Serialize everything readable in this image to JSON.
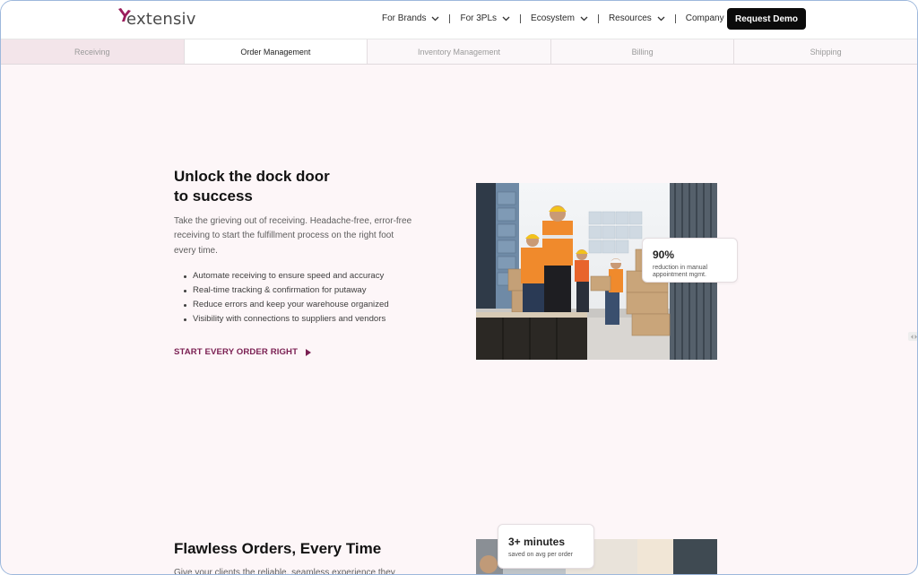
{
  "brand": {
    "logo_text": "extensiv",
    "accent": "#9b1d5c"
  },
  "nav": {
    "items": [
      {
        "label": "For Brands"
      },
      {
        "label": "For 3PLs"
      },
      {
        "label": "Ecosystem"
      },
      {
        "label": "Resources"
      },
      {
        "label": "Company"
      }
    ],
    "cta_label": "Request Demo"
  },
  "tabs": [
    {
      "label": "Receiving"
    },
    {
      "label": "Order Management"
    },
    {
      "label": "Inventory Management"
    },
    {
      "label": "Billing"
    },
    {
      "label": "Shipping"
    }
  ],
  "section1": {
    "title_line1": "Unlock the dock door",
    "title_line2": "to success",
    "lead": "Take the grieving out of receiving. Headache-free, error-free receiving to start the fulfillment process on the right foot every time.",
    "bullets": [
      "Automate receiving to ensure speed and accuracy",
      "Real-time tracking & confirmation for putaway",
      "Reduce errors and keep your warehouse organized",
      "Visibility with connections to suppliers and vendors"
    ],
    "cta_label": "START EVERY ORDER RIGHT",
    "stat_value": "90%",
    "stat_label": "reduction in manual appointment mgmt."
  },
  "section2": {
    "title": "Flawless Orders, Every Time",
    "lead": "Give your clients the reliable, seamless experience they",
    "stat_value": "3+ minutes",
    "stat_label": "saved on avg per order"
  },
  "colors": {
    "cta_text": "#7a1f52",
    "page_bg": "#fdf6f8",
    "button_bg": "#0b0b0b"
  }
}
